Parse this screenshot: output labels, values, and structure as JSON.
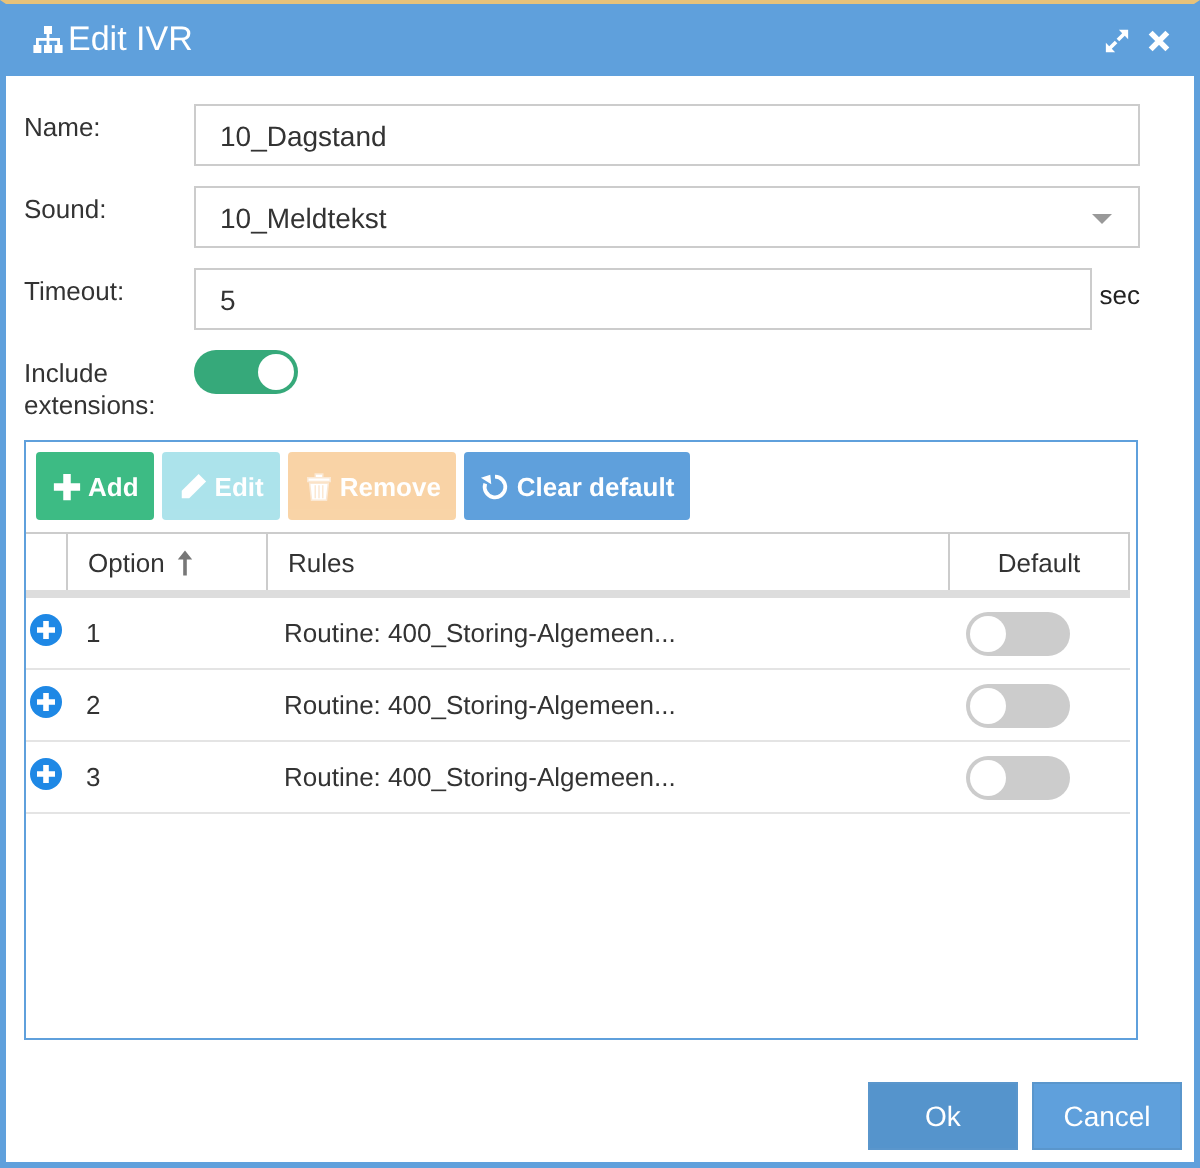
{
  "window": {
    "title": "Edit IVR"
  },
  "form": {
    "name": {
      "label": "Name:",
      "value": "10_Dagstand"
    },
    "sound": {
      "label": "Sound:",
      "value": "10_Meldtekst"
    },
    "timeout": {
      "label": "Timeout:",
      "value": "5",
      "unit": "sec"
    },
    "include_extensions": {
      "label": "Include extensions:",
      "on": true
    }
  },
  "toolbar": [
    {
      "kind": "add",
      "label": "Add",
      "disabled": false
    },
    {
      "kind": "edit",
      "label": "Edit",
      "disabled": true
    },
    {
      "kind": "remove",
      "label": "Remove",
      "disabled": true
    },
    {
      "kind": "clear",
      "label": "Clear default",
      "disabled": false
    }
  ],
  "table": {
    "columns": [
      "Option",
      "Rules",
      "Default"
    ],
    "sorted_ascending": true,
    "rows": [
      {
        "option": "1",
        "rules": "Routine: 400_Storing-Algemeen...",
        "default": false
      },
      {
        "option": "2",
        "rules": "Routine: 400_Storing-Algemeen...",
        "default": false
      },
      {
        "option": "3",
        "rules": "Routine: 400_Storing-Algemeen...",
        "default": false
      }
    ]
  },
  "buttons": [
    "Ok",
    "Cancel"
  ]
}
